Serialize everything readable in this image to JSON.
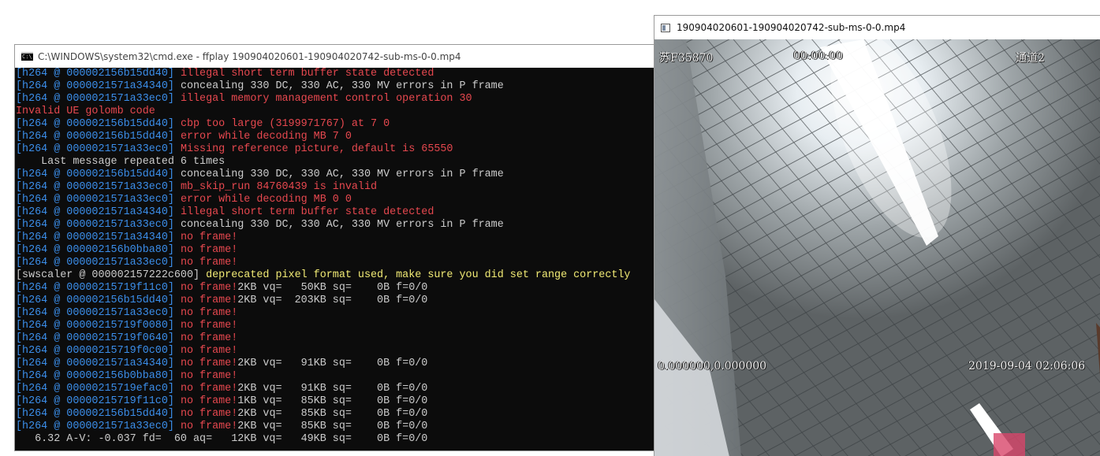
{
  "console_window": {
    "title": "C:\\WINDOWS\\system32\\cmd.exe - ffplay  190904020601-190904020742-sub-ms-0-0.mp4",
    "icon": "cmd-icon",
    "lines": [
      {
        "prefix": "[h264 @ 000002156b15dd40] ",
        "text": "illegal short term buffer state detected",
        "kind": "err"
      },
      {
        "prefix": "[h264 @ 0000021571a34340] ",
        "text": "concealing 330 DC, 330 AC, 330 MV errors in P frame",
        "kind": "nrm"
      },
      {
        "prefix": "[h264 @ 0000021571a33ec0] ",
        "text": "illegal memory management control operation 30",
        "kind": "err"
      },
      {
        "prefix": "",
        "text": "Invalid UE golomb code",
        "kind": "err"
      },
      {
        "prefix": "[h264 @ 000002156b15dd40] ",
        "text": "cbp too large (3199971767) at 7 0",
        "kind": "err"
      },
      {
        "prefix": "[h264 @ 000002156b15dd40] ",
        "text": "error while decoding MB 7 0",
        "kind": "err"
      },
      {
        "prefix": "[h264 @ 0000021571a33ec0] ",
        "text": "Missing reference picture, default is 65550",
        "kind": "err"
      },
      {
        "prefix": "",
        "text": "    Last message repeated 6 times",
        "kind": "nrm"
      },
      {
        "prefix": "[h264 @ 000002156b15dd40] ",
        "text": "concealing 330 DC, 330 AC, 330 MV errors in P frame",
        "kind": "nrm"
      },
      {
        "prefix": "[h264 @ 0000021571a33ec0] ",
        "text": "mb_skip_run 84760439 is invalid",
        "kind": "err"
      },
      {
        "prefix": "[h264 @ 0000021571a33ec0] ",
        "text": "error while decoding MB 0 0",
        "kind": "err"
      },
      {
        "prefix": "[h264 @ 0000021571a34340] ",
        "text": "illegal short term buffer state detected",
        "kind": "err"
      },
      {
        "prefix": "[h264 @ 0000021571a33ec0] ",
        "text": "concealing 330 DC, 330 AC, 330 MV errors in P frame",
        "kind": "nrm"
      },
      {
        "prefix": "[h264 @ 0000021571a34340] ",
        "text": "no frame!",
        "kind": "err"
      },
      {
        "prefix": "[h264 @ 000002156b0bba80] ",
        "text": "no frame!",
        "kind": "err"
      },
      {
        "prefix": "[h264 @ 0000021571a33ec0] ",
        "text": "no frame!",
        "kind": "err"
      },
      {
        "prefix": "[swscaler @ 000002157222c600] ",
        "text": "deprecated pixel format used, make sure you did set range correctly",
        "kind": "wrn",
        "prefix_kind": "nrm"
      },
      {
        "prefix": "[h264 @ 00000215719f11c0] ",
        "text": "no frame!",
        "kind": "err",
        "suffix": "2KB vq=   50KB sq=    0B f=0/0"
      },
      {
        "prefix": "[h264 @ 000002156b15dd40] ",
        "text": "no frame!",
        "kind": "err",
        "suffix": "2KB vq=  203KB sq=    0B f=0/0"
      },
      {
        "prefix": "[h264 @ 0000021571a33ec0] ",
        "text": "no frame!",
        "kind": "err"
      },
      {
        "prefix": "[h264 @ 00000215719f0080] ",
        "text": "no frame!",
        "kind": "err"
      },
      {
        "prefix": "[h264 @ 00000215719f0640] ",
        "text": "no frame!",
        "kind": "err"
      },
      {
        "prefix": "[h264 @ 00000215719f0c00] ",
        "text": "no frame!",
        "kind": "err"
      },
      {
        "prefix": "[h264 @ 0000021571a34340] ",
        "text": "no frame!",
        "kind": "err",
        "suffix": "2KB vq=   91KB sq=    0B f=0/0"
      },
      {
        "prefix": "[h264 @ 000002156b0bba80] ",
        "text": "no frame!",
        "kind": "err"
      },
      {
        "prefix": "[h264 @ 00000215719efac0] ",
        "text": "no frame!",
        "kind": "err",
        "suffix": "2KB vq=   91KB sq=    0B f=0/0"
      },
      {
        "prefix": "[h264 @ 00000215719f11c0] ",
        "text": "no frame!",
        "kind": "err",
        "suffix": "1KB vq=   85KB sq=    0B f=0/0"
      },
      {
        "prefix": "[h264 @ 000002156b15dd40] ",
        "text": "no frame!",
        "kind": "err",
        "suffix": "2KB vq=   85KB sq=    0B f=0/0"
      },
      {
        "prefix": "[h264 @ 0000021571a33ec0] ",
        "text": "no frame!",
        "kind": "err",
        "suffix": "2KB vq=   85KB sq=    0B f=0/0"
      },
      {
        "prefix": "",
        "text": "   6.32 A-V: -0.037 fd=  60 aq=   12KB vq=   49KB sq=    0B f=0/0",
        "kind": "nrm"
      }
    ]
  },
  "video_window": {
    "title": "190904020601-190904020742-sub-ms-0-0.mp4",
    "icon": "video-file-icon",
    "osd": {
      "plate": "苏F35870",
      "timer": "00:00:00",
      "channel": "通道2",
      "coords": "0.000000,0.000000",
      "datetime": "2019-09-04 02:06:06"
    }
  },
  "colors": {
    "console_bg": "#0c0c0c",
    "prefix": "#3b8eea",
    "error": "#e7484f",
    "warning": "#f2eb75",
    "normal": "#cccccc"
  }
}
